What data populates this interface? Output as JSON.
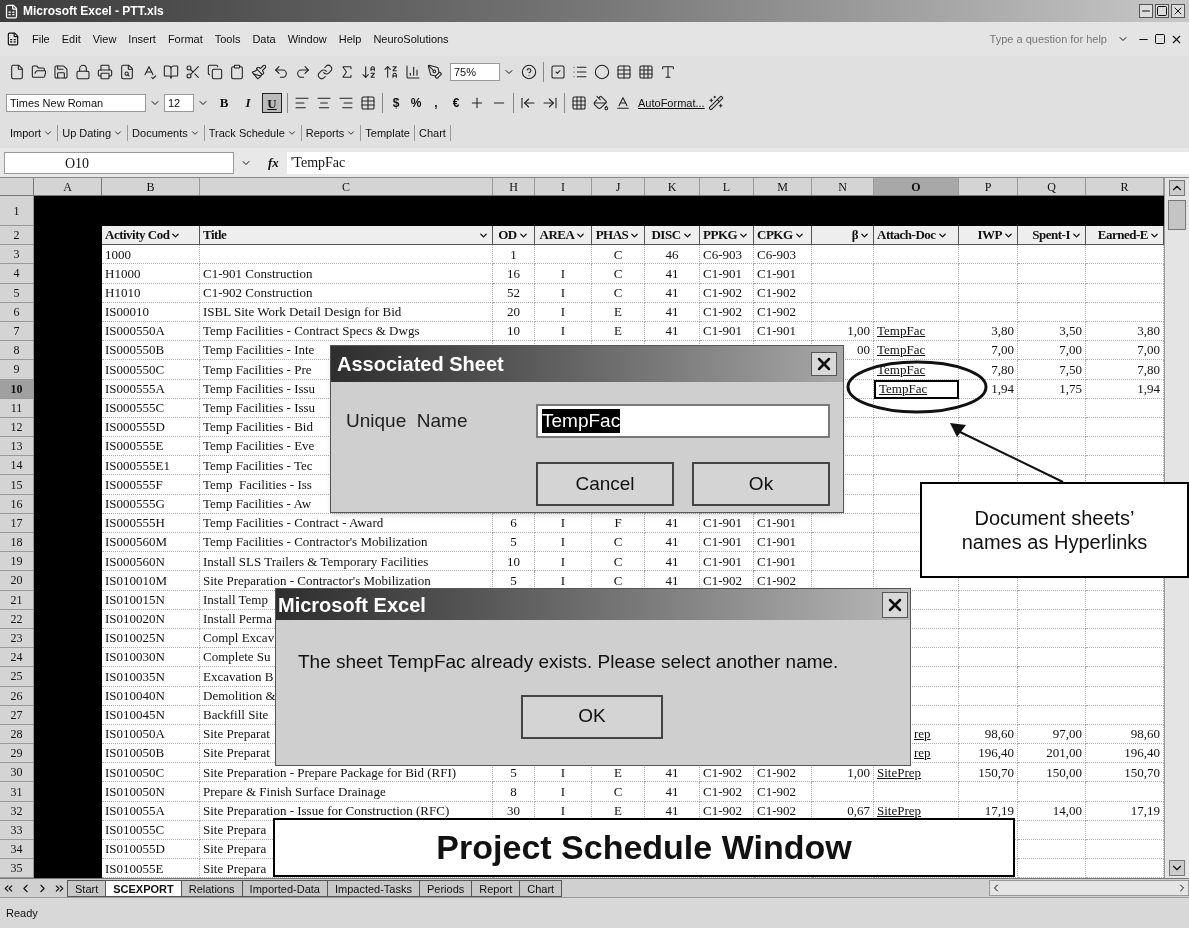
{
  "window": {
    "title": "Microsoft Excel - PTT.xls"
  },
  "menu_bar": {
    "items": [
      "File",
      "Edit",
      "View",
      "Insert",
      "Format",
      "Tools",
      "Data",
      "Window",
      "Help",
      "NeuroSolutions"
    ],
    "help_placeholder": "Type a question for help"
  },
  "standard_toolbar": {
    "zoom": "75%"
  },
  "formatting_toolbar": {
    "font": "Times New Roman",
    "size": "12",
    "style_buttons": [
      {
        "label": "B",
        "selected": false
      },
      {
        "label": "I",
        "selected": false
      },
      {
        "label": "U",
        "selected": true
      }
    ],
    "number_buttons": [
      "$",
      "%",
      ",",
      "€"
    ],
    "autoformat": "AutoFormat..."
  },
  "custom_toolbar": {
    "items": [
      {
        "label": "Import",
        "dropdown": true
      },
      {
        "label": "Up Dating",
        "dropdown": true
      },
      {
        "label": "Documents",
        "dropdown": true
      },
      {
        "label": "Track Schedule",
        "dropdown": true
      },
      {
        "label": "Reports",
        "dropdown": true
      },
      {
        "label": "Template",
        "dropdown": false
      },
      {
        "label": "Chart",
        "dropdown": false
      }
    ]
  },
  "formula_bar": {
    "name_box": "O10",
    "function_label": "fx",
    "value": "'TempFac"
  },
  "sheet": {
    "column_letters": [
      "A",
      "B",
      "C",
      "H",
      "I",
      "J",
      "K",
      "L",
      "M",
      "N",
      "O",
      "P",
      "Q",
      "R"
    ],
    "headers": [
      "Activity Cod",
      "Title",
      "OD",
      "AREA",
      "PHAS",
      "DISC",
      "PPKG",
      "CPKG",
      "β",
      "Attach-Doc",
      "IWP",
      "Spent-I",
      "Earned-E"
    ],
    "rows": [
      {
        "n": "1",
        "selected": false
      },
      {
        "n": "2",
        "selected": false
      },
      {
        "n": "3",
        "selected": false,
        "code": "1000",
        "od": "1",
        "phas": "C",
        "disc": "46",
        "ppkg": "C6-903",
        "cpkg": "C6-903"
      },
      {
        "n": "4",
        "selected": false,
        "code": "H1000",
        "title": "C1-901 Construction",
        "od": "16",
        "area": "I",
        "phas": "C",
        "disc": "41",
        "ppkg": "C1-901",
        "cpkg": "C1-901"
      },
      {
        "n": "5",
        "selected": false,
        "code": "H1010",
        "title": "C1-902 Construction",
        "od": "52",
        "area": "I",
        "phas": "C",
        "disc": "41",
        "ppkg": "C1-902",
        "cpkg": "C1-902"
      },
      {
        "n": "6",
        "selected": false,
        "code": "IS00010",
        "title": "ISBL Site Work Detail Design for Bid",
        "od": "20",
        "area": "I",
        "phas": "E",
        "disc": "41",
        "ppkg": "C1-902",
        "cpkg": "C1-902"
      },
      {
        "n": "7",
        "selected": false,
        "code": "IS000550A",
        "title": "Temp Facilities - Contract Specs & Dwgs",
        "od": "10",
        "area": "I",
        "phas": "E",
        "disc": "41",
        "ppkg": "C1-901",
        "cpkg": "C1-901",
        "beta": "1,00",
        "doc": "TempFac",
        "iwp": "3,80",
        "spent": "3,50",
        "earned": "3,80"
      },
      {
        "n": "8",
        "selected": false,
        "code": "IS000550B",
        "title": "Temp Facilities - Inte",
        "beta": "00",
        "doc": "TempFac",
        "iwp": "7,00",
        "spent": "7,00",
        "earned": "7,00"
      },
      {
        "n": "9",
        "selected": false,
        "code": "IS000550C",
        "title": "Temp Facilities - Pre",
        "doc": "TempFac",
        "iwp": "7,80",
        "spent": "7,50",
        "earned": "7,80"
      },
      {
        "n": "10",
        "selected": true,
        "code": "IS000555A",
        "title": "Temp Facilities - Issu",
        "doc": "TempFac",
        "iwp": "1,94",
        "spent": "1,75",
        "earned": "1,94"
      },
      {
        "n": "11",
        "selected": false,
        "code": "IS000555C",
        "title": "Temp Facilities - Issu"
      },
      {
        "n": "12",
        "selected": false,
        "code": "IS000555D",
        "title": "Temp Facilities - Bid"
      },
      {
        "n": "13",
        "selected": false,
        "code": "IS000555E",
        "title": "Temp Facilities - Eve"
      },
      {
        "n": "14",
        "selected": false,
        "code": "IS000555E1",
        "title": "Temp Facilities - Tec"
      },
      {
        "n": "15",
        "selected": false,
        "code": "IS000555F",
        "title": "Temp  Facilities - Iss"
      },
      {
        "n": "16",
        "selected": false,
        "code": "IS000555G",
        "title": "Temp Facilities - Aw"
      },
      {
        "n": "17",
        "selected": false,
        "code": "IS000555H",
        "title": "Temp Facilities - Contract - Award",
        "od": "6",
        "area": "I",
        "phas": "F",
        "disc": "41",
        "ppkg": "C1-901",
        "cpkg": "C1-901"
      },
      {
        "n": "18",
        "selected": false,
        "code": "IS000560M",
        "title": "Temp Facilities - Contractor's Mobilization",
        "od": "5",
        "area": "I",
        "phas": "C",
        "disc": "41",
        "ppkg": "C1-901",
        "cpkg": "C1-901"
      },
      {
        "n": "19",
        "selected": false,
        "code": "IS000560N",
        "title": "Install SLS Trailers & Temporary Facilities",
        "od": "10",
        "area": "I",
        "phas": "C",
        "disc": "41",
        "ppkg": "C1-901",
        "cpkg": "C1-901"
      },
      {
        "n": "20",
        "selected": false,
        "code": "IS010010M",
        "title": "Site Preparation - Contractor's Mobilization",
        "od": "5",
        "area": "I",
        "phas": "C",
        "disc": "41",
        "ppkg": "C1-902",
        "cpkg": "C1-902"
      },
      {
        "n": "21",
        "selected": false,
        "code": "IS010015N",
        "title": "Install Temp"
      },
      {
        "n": "22",
        "selected": false,
        "code": "IS010020N",
        "title": "Install Perma"
      },
      {
        "n": "23",
        "selected": false,
        "code": "IS010025N",
        "title": "Compl Excav"
      },
      {
        "n": "24",
        "selected": false,
        "code": "IS010030N",
        "title": "Complete Su"
      },
      {
        "n": "25",
        "selected": false,
        "code": "IS010035N",
        "title": "Excavation B"
      },
      {
        "n": "26",
        "selected": false,
        "code": "IS010040N",
        "title": "Demolition &"
      },
      {
        "n": "27",
        "selected": false,
        "code": "IS010045N",
        "title": "Backfill Site"
      },
      {
        "n": "28",
        "selected": false,
        "code": "IS010050A",
        "title": "Site Preparat",
        "doc": "rep",
        "iwp": "98,60",
        "spent": "97,00",
        "earned": "98,60"
      },
      {
        "n": "29",
        "selected": false,
        "code": "IS010050B",
        "title": "Site Preparat",
        "doc": "rep",
        "iwp": "196,40",
        "spent": "201,00",
        "earned": "196,40"
      },
      {
        "n": "30",
        "selected": false,
        "code": "IS010050C",
        "title": "Site Preparation - Prepare Package for Bid (RFI)",
        "od": "5",
        "area": "I",
        "phas": "E",
        "disc": "41",
        "ppkg": "C1-902",
        "cpkg": "C1-902",
        "beta": "1,00",
        "doc": "SitePrep",
        "iwp": "150,70",
        "spent": "150,00",
        "earned": "150,70"
      },
      {
        "n": "31",
        "selected": false,
        "code": "IS010050N",
        "title": "Prepare & Finish Surface Drainage",
        "od": "8",
        "area": "I",
        "phas": "C",
        "disc": "41",
        "ppkg": "C1-902",
        "cpkg": "C1-902"
      },
      {
        "n": "32",
        "selected": false,
        "code": "IS010055A",
        "title": "Site Preparation - Issue for Construction (RFC)",
        "od": "30",
        "area": "I",
        "phas": "E",
        "disc": "41",
        "ppkg": "C1-902",
        "cpkg": "C1-902",
        "beta": "0,67",
        "doc": "SitePrep",
        "iwp": "17,19",
        "spent": "14,00",
        "earned": "17,19"
      },
      {
        "n": "33",
        "selected": false,
        "code": "IS010055C",
        "title": "Site Prepara"
      },
      {
        "n": "34",
        "selected": false,
        "code": "IS010055D",
        "title": "Site Prepara"
      },
      {
        "n": "35",
        "selected": false,
        "code": "IS010055E",
        "title": "Site Prepara"
      }
    ]
  },
  "associated_sheet_dialog": {
    "title": "Associated Sheet",
    "label": "Unique  Name",
    "value": "TempFac",
    "buttons": [
      "Cancel",
      "Ok"
    ]
  },
  "message_dialog": {
    "title": "Microsoft Excel",
    "message": "The sheet TempFac already exists. Please select another name.",
    "buttons": [
      "OK"
    ]
  },
  "callouts": [
    {
      "kind": "note",
      "text": "Document sheets’ names as Hyperlinks"
    },
    {
      "kind": "banner",
      "text": "Project Schedule Window"
    }
  ],
  "sheet_tabs": [
    {
      "label": "Start",
      "selected": false
    },
    {
      "label": "SCEXPORT",
      "selected": true
    },
    {
      "label": "Relations",
      "selected": false
    },
    {
      "label": "Imported-Data",
      "selected": false
    },
    {
      "label": "Impacted-Tasks",
      "selected": false
    },
    {
      "label": "Periods",
      "selected": false
    },
    {
      "label": "Report",
      "selected": false
    },
    {
      "label": "Chart",
      "selected": false
    }
  ],
  "status_bar": {
    "text": "Ready"
  }
}
